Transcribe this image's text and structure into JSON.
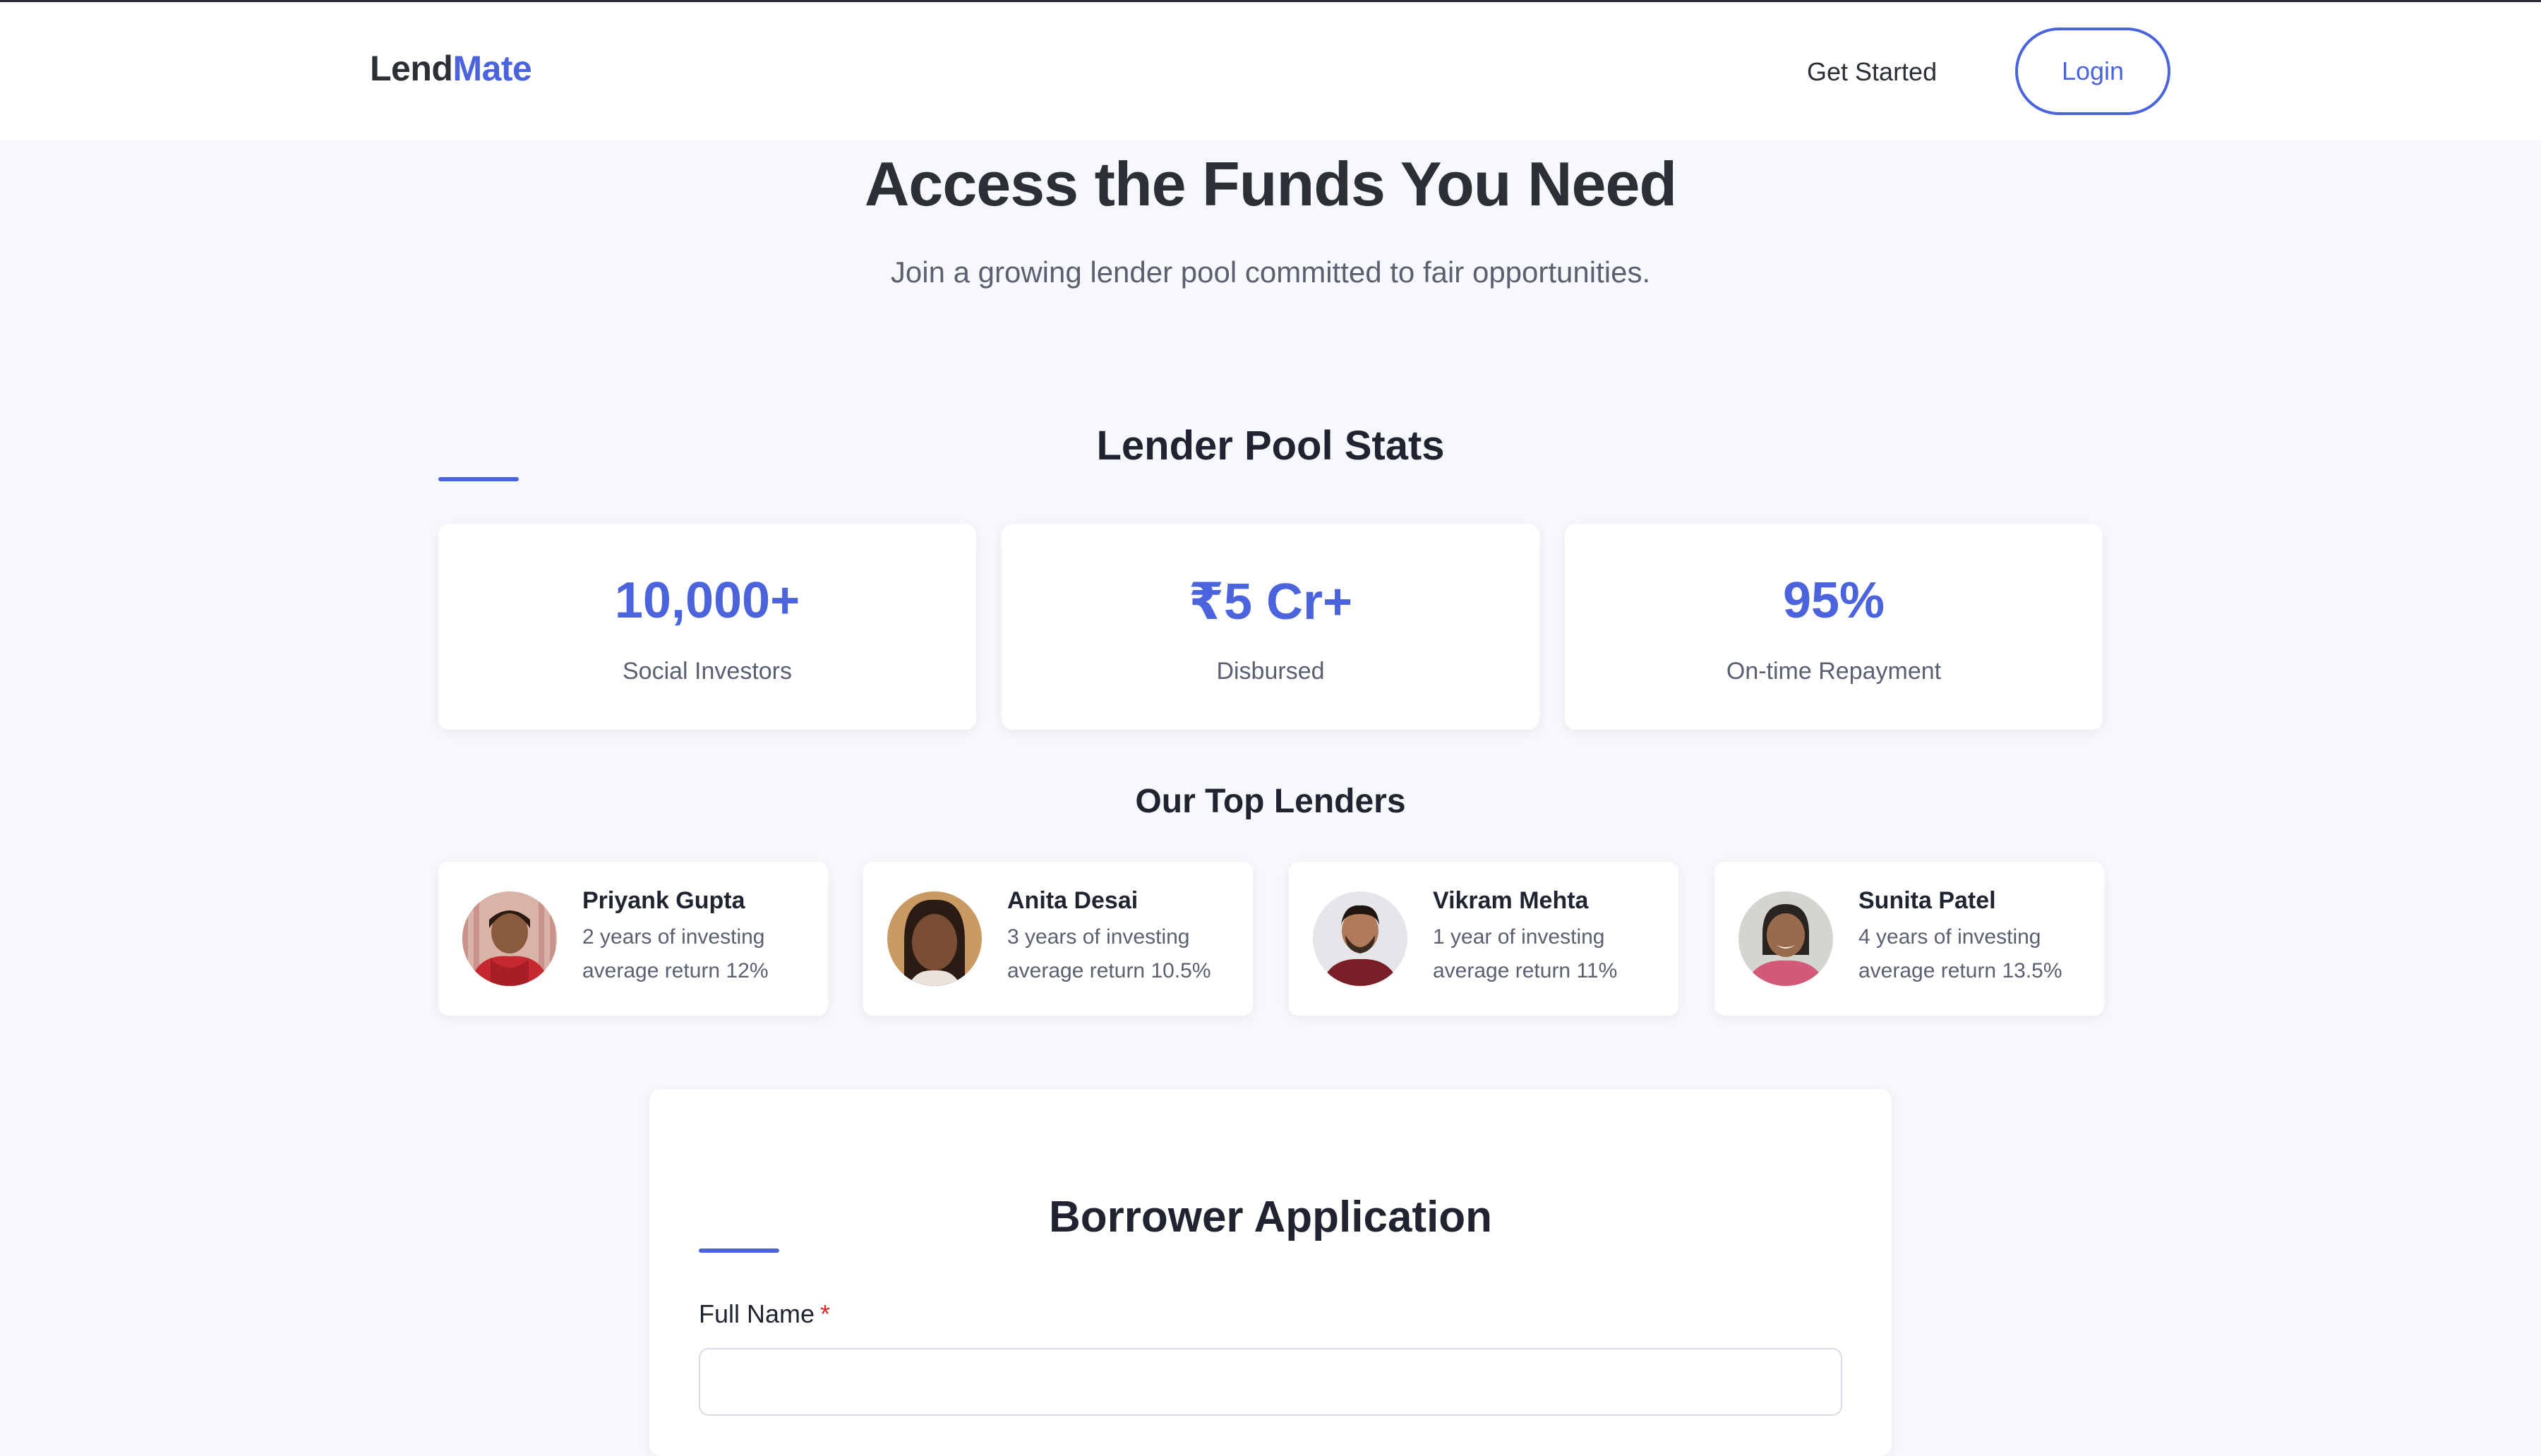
{
  "header": {
    "logo_part1": "Lend",
    "logo_part2": "Mate",
    "get_started": "Get Started",
    "login": "Login"
  },
  "hero": {
    "title": "Access the Funds You Need",
    "subtitle": "Join a growing lender pool committed to fair opportunities."
  },
  "stats": {
    "title": "Lender Pool Stats",
    "items": [
      {
        "value": "10,000+",
        "label": "Social Investors"
      },
      {
        "value": "₹5 Cr+",
        "label": "Disbursed"
      },
      {
        "value": "95%",
        "label": "On-time Repayment"
      }
    ]
  },
  "lenders": {
    "title": "Our Top Lenders",
    "items": [
      {
        "name": "Priyank Gupta",
        "years": "2 years of investing",
        "return": "average return 12%"
      },
      {
        "name": "Anita Desai",
        "years": "3 years of investing",
        "return": "average return 10.5%"
      },
      {
        "name": "Vikram Mehta",
        "years": "1 year of investing",
        "return": "average return 11%"
      },
      {
        "name": "Sunita Patel",
        "years": "4 years of investing",
        "return": "average return 13.5%"
      }
    ]
  },
  "form": {
    "title": "Borrower Application",
    "full_name_label": "Full Name",
    "required_mark": "*",
    "full_name_value": ""
  },
  "colors": {
    "accent": "#4b63dc",
    "background": "#f7f8fb",
    "required": "#d62828"
  }
}
